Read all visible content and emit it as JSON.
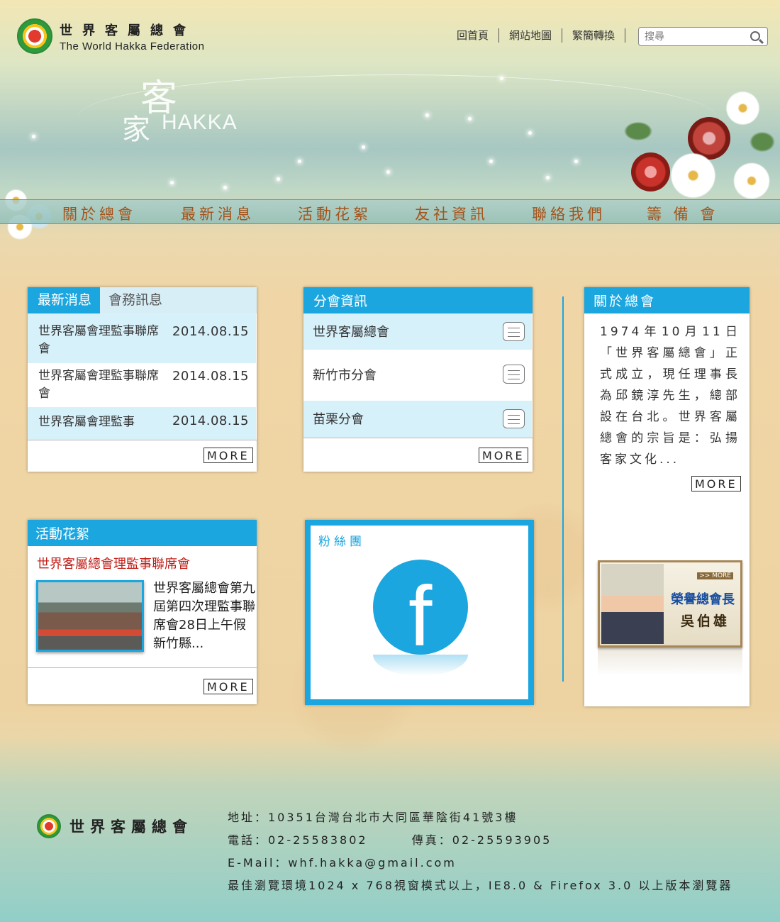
{
  "header": {
    "logo_cn": "世界客屬總會",
    "logo_en": "The World Hakka Federation",
    "links": [
      "回首頁",
      "網站地圖",
      "繁簡轉換"
    ],
    "search_placeholder": "搜尋"
  },
  "banner": {
    "ke": "客",
    "jia": "家",
    "hakka": "HAKKA"
  },
  "nav": [
    "關於總會",
    "最新消息",
    "活動花絮",
    "友社資訊",
    "聯絡我們",
    "籌 備 會"
  ],
  "news_panel": {
    "tabs": [
      "最新消息",
      "會務訊息"
    ],
    "items": [
      {
        "title": "世界客屬會理監事聯席會",
        "date": "2014.08.15"
      },
      {
        "title": "世界客屬會理監事聯席會",
        "date": "2014.08.15"
      },
      {
        "title": "世界客屬會理監事",
        "date": "2014.08.15"
      }
    ],
    "more": "MORE"
  },
  "branch_panel": {
    "title": "分會資訊",
    "items": [
      "世界客屬總會",
      "新竹市分會",
      "苗栗分會"
    ],
    "more": "MORE"
  },
  "about_panel": {
    "title": "關於總會",
    "text": "1974年10月11日「世界客屬總會」正式成立，現任理事長為邱鏡淳先生，總部設在台北。世界客屬總會的宗旨是：弘揚客家文化...",
    "more": "MORE"
  },
  "activity_panel": {
    "title": "活動花絮",
    "headline": "世界客屬總會理監事聯席會",
    "desc": "世界客屬總會第九屆第四次理監事聯席會28日上午假新竹縣...",
    "more": "MORE"
  },
  "fb_panel": {
    "title": "粉絲團",
    "icon_letter": "f"
  },
  "president": {
    "badge": ">> MORE",
    "line1": "榮譽總會長",
    "line2": "吳伯雄"
  },
  "footer": {
    "name": "世界客屬總會",
    "address": "地址：10351台灣台北市大同區華陰街41號3樓",
    "phone": "電話：02-25583802",
    "fax": "傳真：02-25593905",
    "email": "E-Mail：whf.hakka@gmail.com",
    "browser": "最佳瀏覽環境1024 x 768視窗模式以上，IE8.0 & Firefox 3.0 以上版本瀏覽器"
  },
  "colors": {
    "accent": "#1ba6df",
    "nav_text": "#a5531a",
    "headline": "#c0201a"
  }
}
